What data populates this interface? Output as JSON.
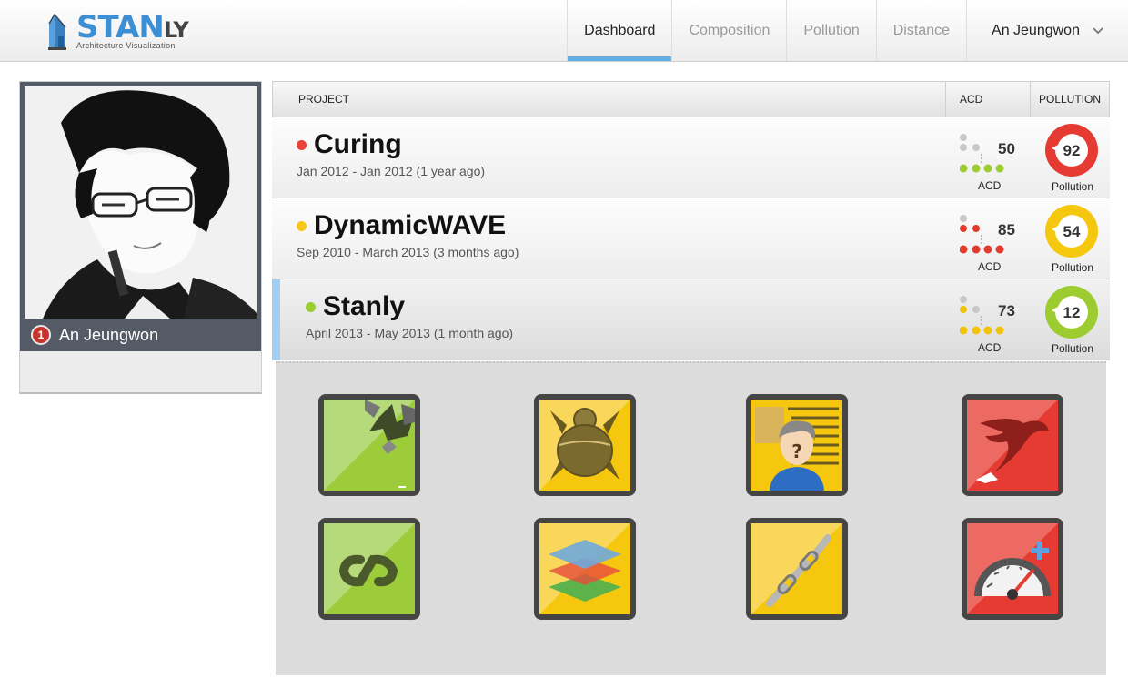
{
  "header": {
    "logo_text": "STAN",
    "logo_suffix": "LY",
    "logo_tagline": "Architecture Visualization",
    "tabs": [
      {
        "label": "Dashboard",
        "active": true
      },
      {
        "label": "Composition",
        "active": false
      },
      {
        "label": "Pollution",
        "active": false
      },
      {
        "label": "Distance",
        "active": false
      }
    ],
    "user_name": "An Jeungwon"
  },
  "profile": {
    "name": "An Jeungwon",
    "badge_count": "1"
  },
  "table": {
    "headers": {
      "project": "PROJECT",
      "acd": "ACD",
      "pollution": "POLLUTION"
    },
    "rows": [
      {
        "title": "Curing",
        "dates": "Jan 2012 - Jan 2012 (1 year ago)",
        "status_color": "#e8423a",
        "acd": "50",
        "acd_label": "ACD",
        "acd_color": "#9ccc2f",
        "pollution": "92",
        "pollution_label": "Pollution",
        "pollution_color": "#e53b33",
        "selected": false
      },
      {
        "title": "DynamicWAVE",
        "dates": "Sep 2010 - March 2013 (3 months ago)",
        "status_color": "#f5c91a",
        "acd": "85",
        "acd_label": "ACD",
        "acd_color": "#e03b2e",
        "pollution": "54",
        "pollution_label": "Pollution",
        "pollution_color": "#f5c70f",
        "selected": false
      },
      {
        "title": "Stanly",
        "dates": "April 2013 - May 2013 (1 month ago)",
        "status_color": "#9ccc2f",
        "acd": "73",
        "acd_label": "ACD",
        "acd_color": "#f2c20b",
        "pollution": "12",
        "pollution_label": "Pollution",
        "pollution_color": "#9ccc2f",
        "selected": true
      }
    ]
  },
  "apps": [
    {
      "icon": "broken-tile-icon",
      "color": "green"
    },
    {
      "icon": "bug-icon",
      "color": "yellow"
    },
    {
      "icon": "unknown-person-icon",
      "color": "yellow"
    },
    {
      "icon": "gazelle-icon",
      "color": "red"
    },
    {
      "icon": "infinity-link-icon",
      "color": "green"
    },
    {
      "icon": "layers-icon",
      "color": "yellow"
    },
    {
      "icon": "chain-icon",
      "color": "yellow"
    },
    {
      "icon": "speedometer-add-icon",
      "color": "red"
    }
  ]
}
